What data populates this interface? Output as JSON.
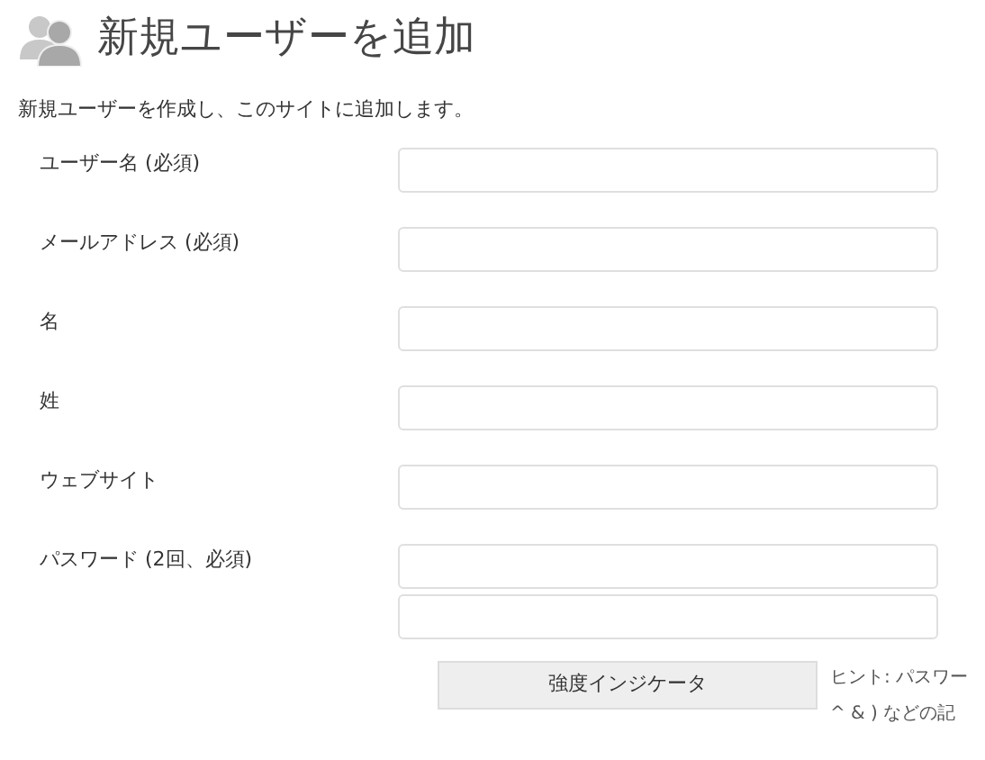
{
  "title": "新規ユーザーを追加",
  "description": "新規ユーザーを作成し、このサイトに追加します。",
  "fields": [
    {
      "label": "ユーザー名 (必須)",
      "kind": "single"
    },
    {
      "label": "メールアドレス (必須)",
      "kind": "single"
    },
    {
      "label": "名",
      "kind": "single"
    },
    {
      "label": "姓",
      "kind": "single"
    },
    {
      "label": "ウェブサイト",
      "kind": "single"
    },
    {
      "label": "パスワード (2回、必須)",
      "kind": "double"
    }
  ],
  "strength_indicator": "強度インジケータ",
  "hint": [
    "ヒント: パスワー",
    "^ & ) などの記"
  ]
}
